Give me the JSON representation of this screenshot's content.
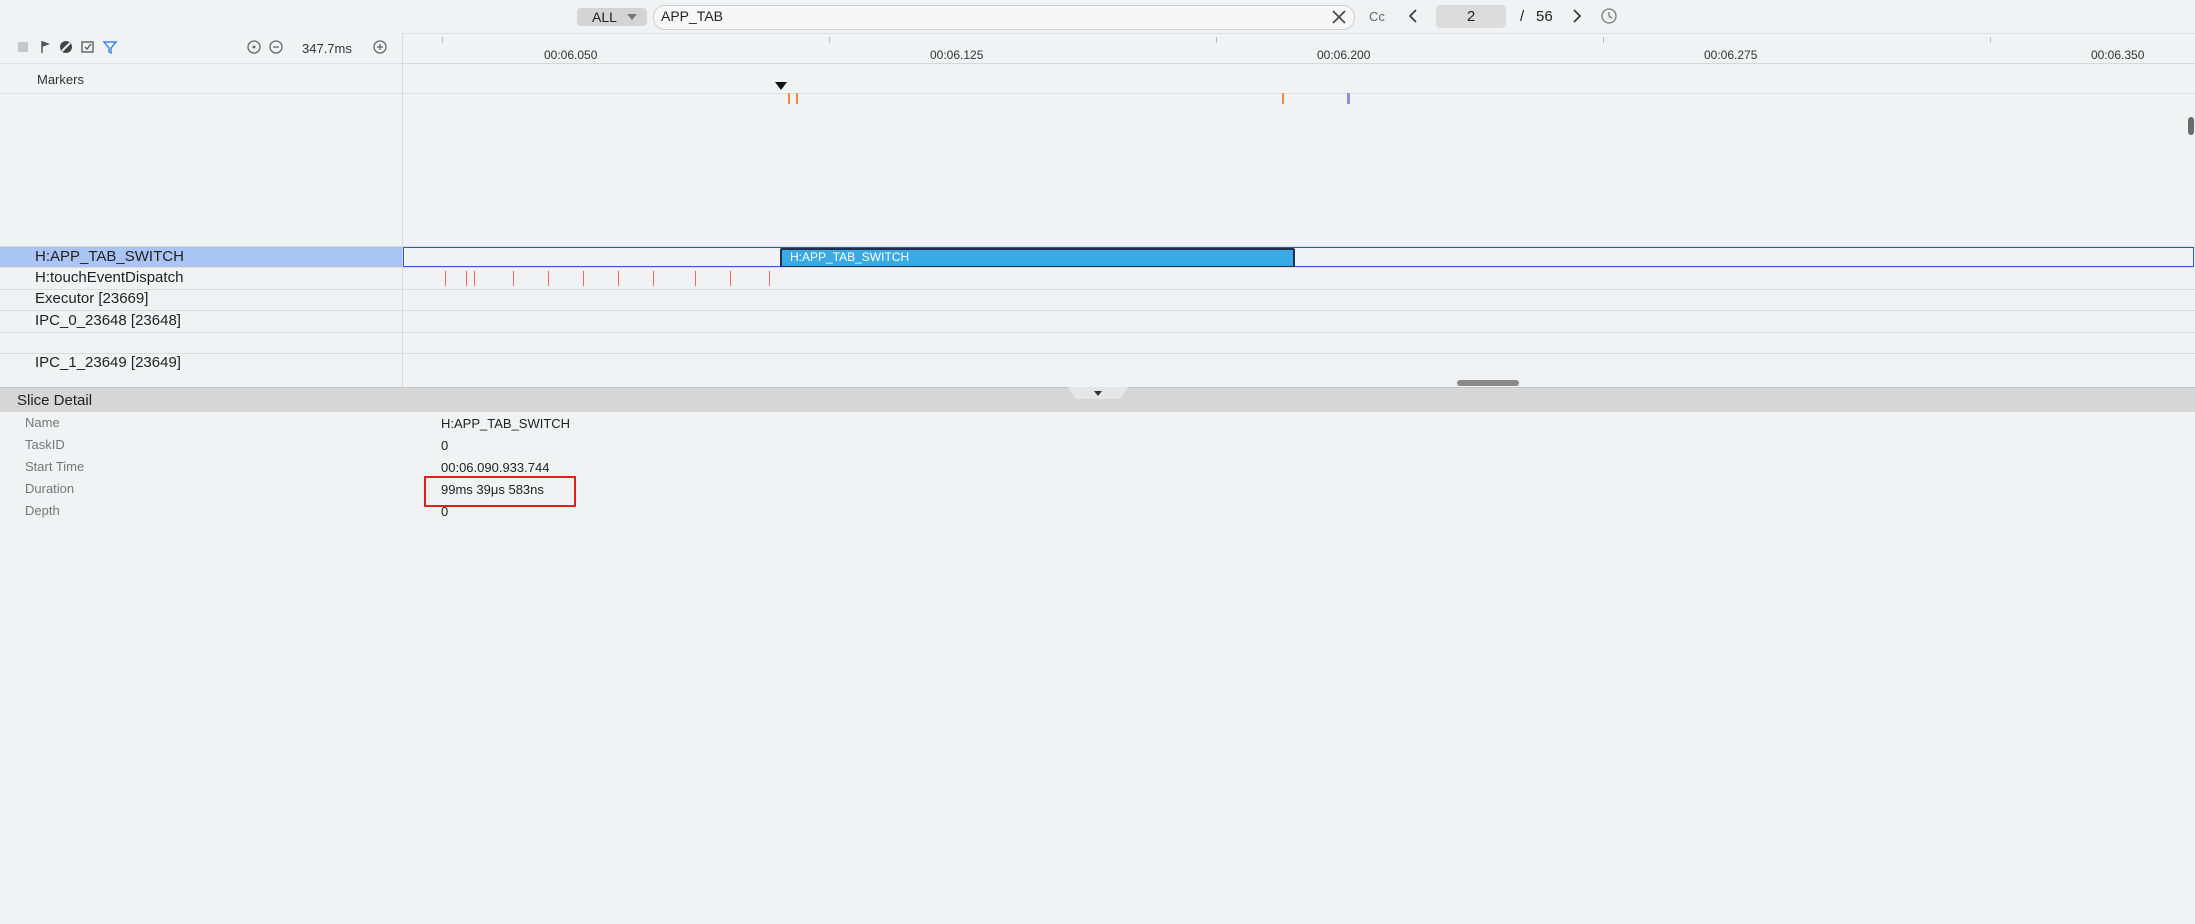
{
  "search": {
    "scope": "ALL",
    "query": "APP_TAB",
    "case_label": "Cc",
    "current_page": "2",
    "page_separator": "/",
    "total_pages": "56"
  },
  "toolbar": {
    "zoom": "347.7ms"
  },
  "ruler": {
    "ticks": [
      "00:06.050",
      "00:06.125",
      "00:06.200",
      "00:06.275",
      "00:06.350"
    ]
  },
  "markers": {
    "label": "Markers"
  },
  "tracks": [
    {
      "label": "H:APP_TAB_SWITCH",
      "slice": "H:APP_TAB_SWITCH"
    },
    {
      "label": "H:touchEventDispatch"
    },
    {
      "label": "Executor [23669]"
    },
    {
      "label": "IPC_0_23648 [23648]"
    },
    {
      "label": "IPC_1_23649 [23649]"
    }
  ],
  "detail": {
    "title": "Slice Detail",
    "fields": [
      {
        "key": "Name",
        "value": "H:APP_TAB_SWITCH"
      },
      {
        "key": "TaskID",
        "value": "0"
      },
      {
        "key": "Start Time",
        "value": "00:06.090.933.744"
      },
      {
        "key": "Duration",
        "value": "99ms 39μs 583ns"
      },
      {
        "key": "Depth",
        "value": "0"
      }
    ]
  },
  "colors": {
    "selected_row": "#aac4f4",
    "slice": "#3aaae4",
    "highlight": "#e21f1f",
    "event_tick": "#f06a6a",
    "marker_orange": "#ee8a3c",
    "marker_purple": "#8f8fd8"
  }
}
